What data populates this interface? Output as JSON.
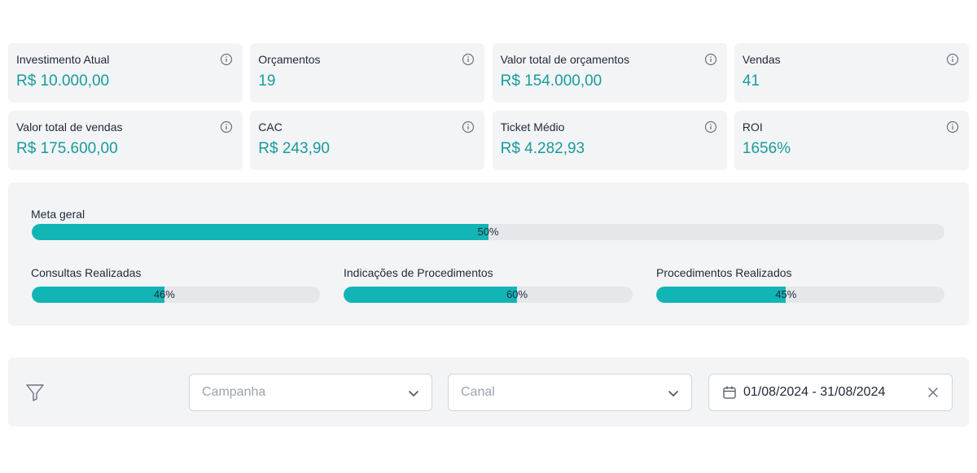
{
  "kpis": [
    {
      "label": "Investimento Atual",
      "value": "R$ 10.000,00"
    },
    {
      "label": "Orçamentos",
      "value": "19"
    },
    {
      "label": "Valor total de orçamentos",
      "value": "R$ 154.000,00"
    },
    {
      "label": "Vendas",
      "value": "41"
    },
    {
      "label": "Valor total de vendas",
      "value": "R$ 175.600,00"
    },
    {
      "label": "CAC",
      "value": "R$ 243,90"
    },
    {
      "label": "Ticket Médio",
      "value": "R$ 4.282,93"
    },
    {
      "label": "ROI",
      "value": "1656%"
    }
  ],
  "goals": {
    "overall": {
      "label": "Meta geral",
      "percent": 50,
      "text": "50%"
    },
    "items": [
      {
        "label": "Consultas Realizadas",
        "percent": 46,
        "text": "46%"
      },
      {
        "label": "Indicações de Procedimentos",
        "percent": 60,
        "text": "60%"
      },
      {
        "label": "Procedimentos Realizados",
        "percent": 45,
        "text": "45%"
      }
    ]
  },
  "filters": {
    "campaign_placeholder": "Campanha",
    "channel_placeholder": "Canal",
    "date_range": "01/08/2024 - 31/08/2024"
  },
  "colors": {
    "accent": "#12b5b5",
    "value_text": "#199b9b",
    "panel_bg": "#f3f4f6",
    "track_bg": "#e5e7eb"
  },
  "icons": {
    "kpi_info": "info-icon",
    "filter": "filter-icon",
    "select_arrow": "chevron-down-icon",
    "date": "calendar-icon",
    "clear": "close-icon"
  }
}
